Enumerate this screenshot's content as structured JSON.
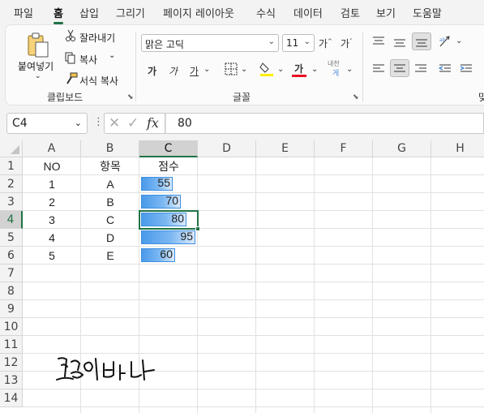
{
  "menu": {
    "tabs": [
      "파일",
      "홈",
      "삽입",
      "그리기",
      "페이지 레이아웃",
      "수식",
      "데이터",
      "검토",
      "보기",
      "도움말"
    ],
    "active": "홈"
  },
  "ribbon": {
    "clipboard": {
      "paste_label": "붙여넣기",
      "cut_label": "잘라내기",
      "copy_label": "복사",
      "format_painter_label": "서식 복사",
      "group_label": "클립보드"
    },
    "font": {
      "font_name": "맑은 고딕",
      "font_size": "11",
      "bold_label": "가",
      "italic_label": "가",
      "underline_label": "가",
      "font_color_label": "가",
      "phonetic_top": "내천",
      "phonetic_bottom": "게",
      "group_label": "글꼴",
      "grow_label": "가",
      "shrink_label": "가"
    },
    "alignment": {
      "group_label_partial": "맞"
    },
    "colors": {
      "fill_color": "#ffef00",
      "font_color": "#e81123",
      "accent": "#217346"
    }
  },
  "formula_bar": {
    "name_box": "C4",
    "fx_label": "fx",
    "value": "80"
  },
  "sheet": {
    "columns": [
      "A",
      "B",
      "C",
      "D",
      "E",
      "F",
      "G",
      "H"
    ],
    "rows": [
      "1",
      "2",
      "3",
      "4",
      "5",
      "6",
      "7",
      "8",
      "9",
      "10",
      "11",
      "12",
      "13",
      "14"
    ],
    "active_cell": "C4",
    "headers": [
      "NO",
      "항목",
      "점수"
    ],
    "data": [
      {
        "no": "1",
        "item": "A",
        "score": "55"
      },
      {
        "no": "2",
        "item": "B",
        "score": "70"
      },
      {
        "no": "3",
        "item": "C",
        "score": "80"
      },
      {
        "no": "4",
        "item": "D",
        "score": "95"
      },
      {
        "no": "5",
        "item": "E",
        "score": "60"
      }
    ],
    "databar_fractions": [
      0.55,
      0.7,
      0.8,
      0.95,
      0.6
    ],
    "signature_text": "교통의 밥니다"
  }
}
